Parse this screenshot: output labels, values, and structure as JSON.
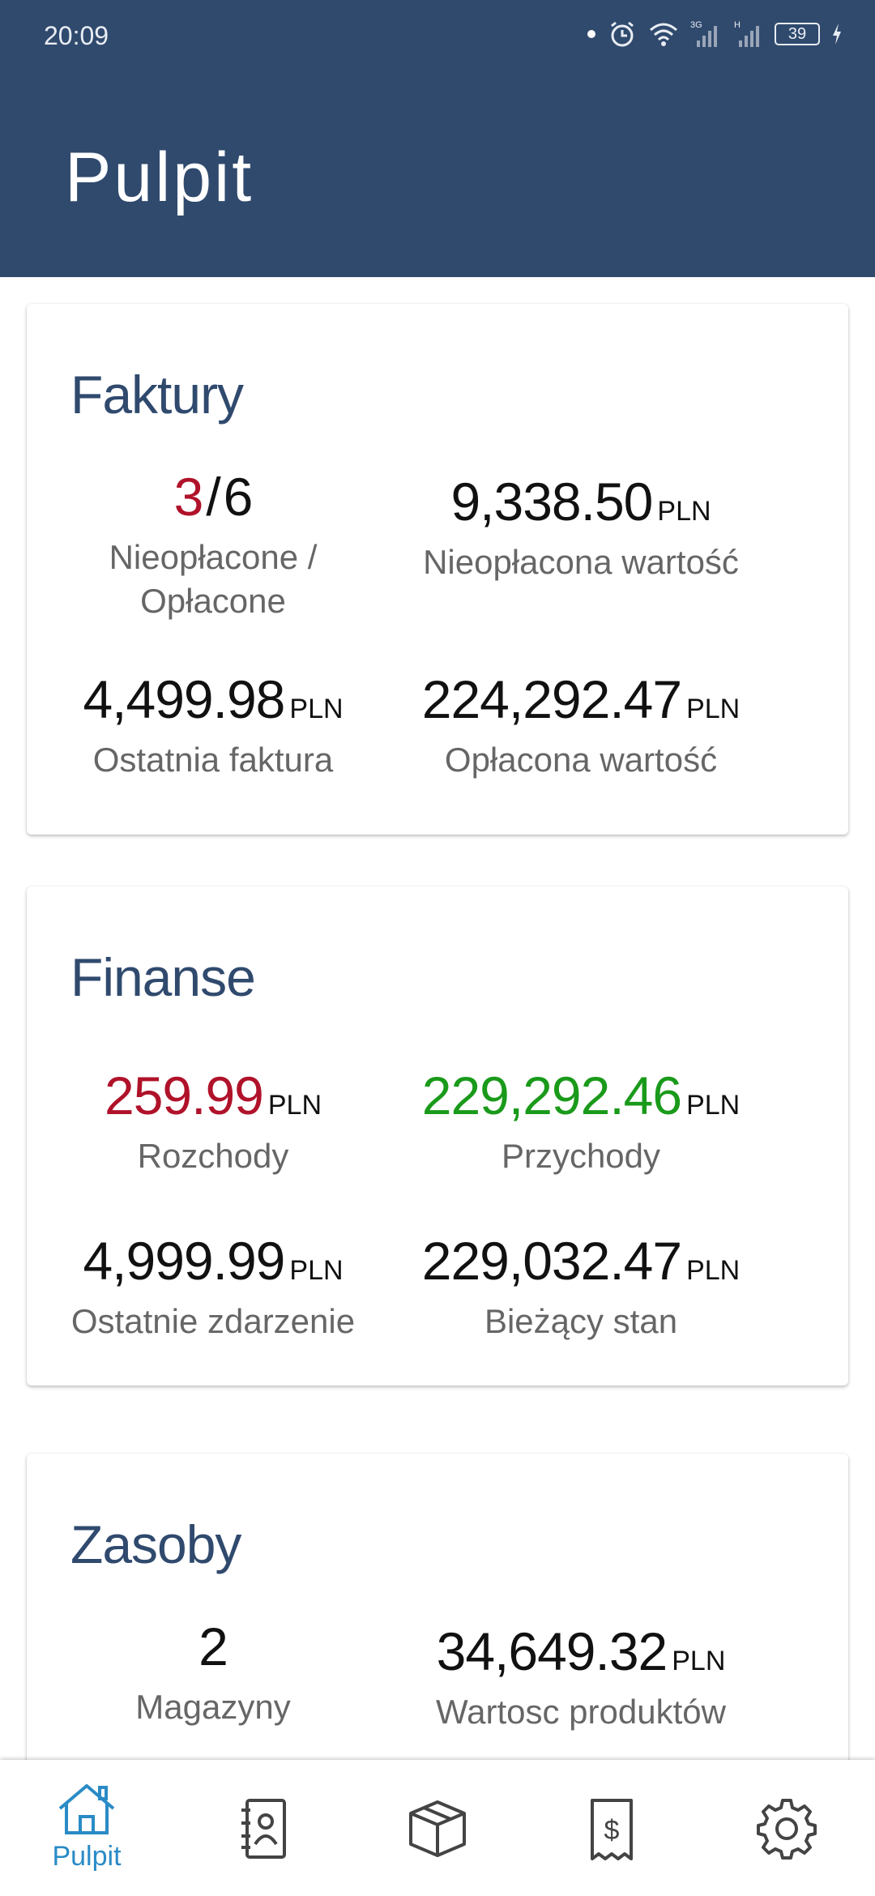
{
  "status_bar": {
    "time": "20:09",
    "battery": "39"
  },
  "header": {
    "title": "Pulpit"
  },
  "cards": {
    "faktury": {
      "title": "Faktury",
      "unpaid_count": "3",
      "separator": "/",
      "total_count": "6",
      "count_label": "Nieopłacone / Opłacone",
      "unpaid_value": "9,338.50",
      "unpaid_value_label": "Nieopłacona wartość",
      "last_invoice": "4,499.98",
      "last_invoice_label": "Ostatnia faktura",
      "paid_value": "224,292.47",
      "paid_value_label": "Opłacona wartość",
      "currency": "PLN"
    },
    "finanse": {
      "title": "Finanse",
      "expenses": "259.99",
      "expenses_label": "Rozchody",
      "income": "229,292.46",
      "income_label": "Przychody",
      "last_event": "4,999.99",
      "last_event_label": "Ostatnie zdarzenie",
      "balance": "229,032.47",
      "balance_label": "Bieżący stan",
      "currency": "PLN"
    },
    "zasoby": {
      "title": "Zasoby",
      "warehouses": "2",
      "warehouses_label": "Magazyny",
      "products_value": "34,649.32",
      "products_value_label": "Wartosc produktów",
      "currency": "PLN"
    }
  },
  "nav": {
    "items": [
      {
        "label": "Pulpit",
        "icon": "home-icon",
        "active": true
      },
      {
        "icon": "contacts-icon"
      },
      {
        "icon": "box-icon"
      },
      {
        "icon": "receipt-icon"
      },
      {
        "icon": "gear-icon"
      }
    ]
  },
  "colors": {
    "header": "#304a6e",
    "negative": "#b0122a",
    "positive": "#1a9a1a",
    "accent": "#2a8bc6"
  }
}
